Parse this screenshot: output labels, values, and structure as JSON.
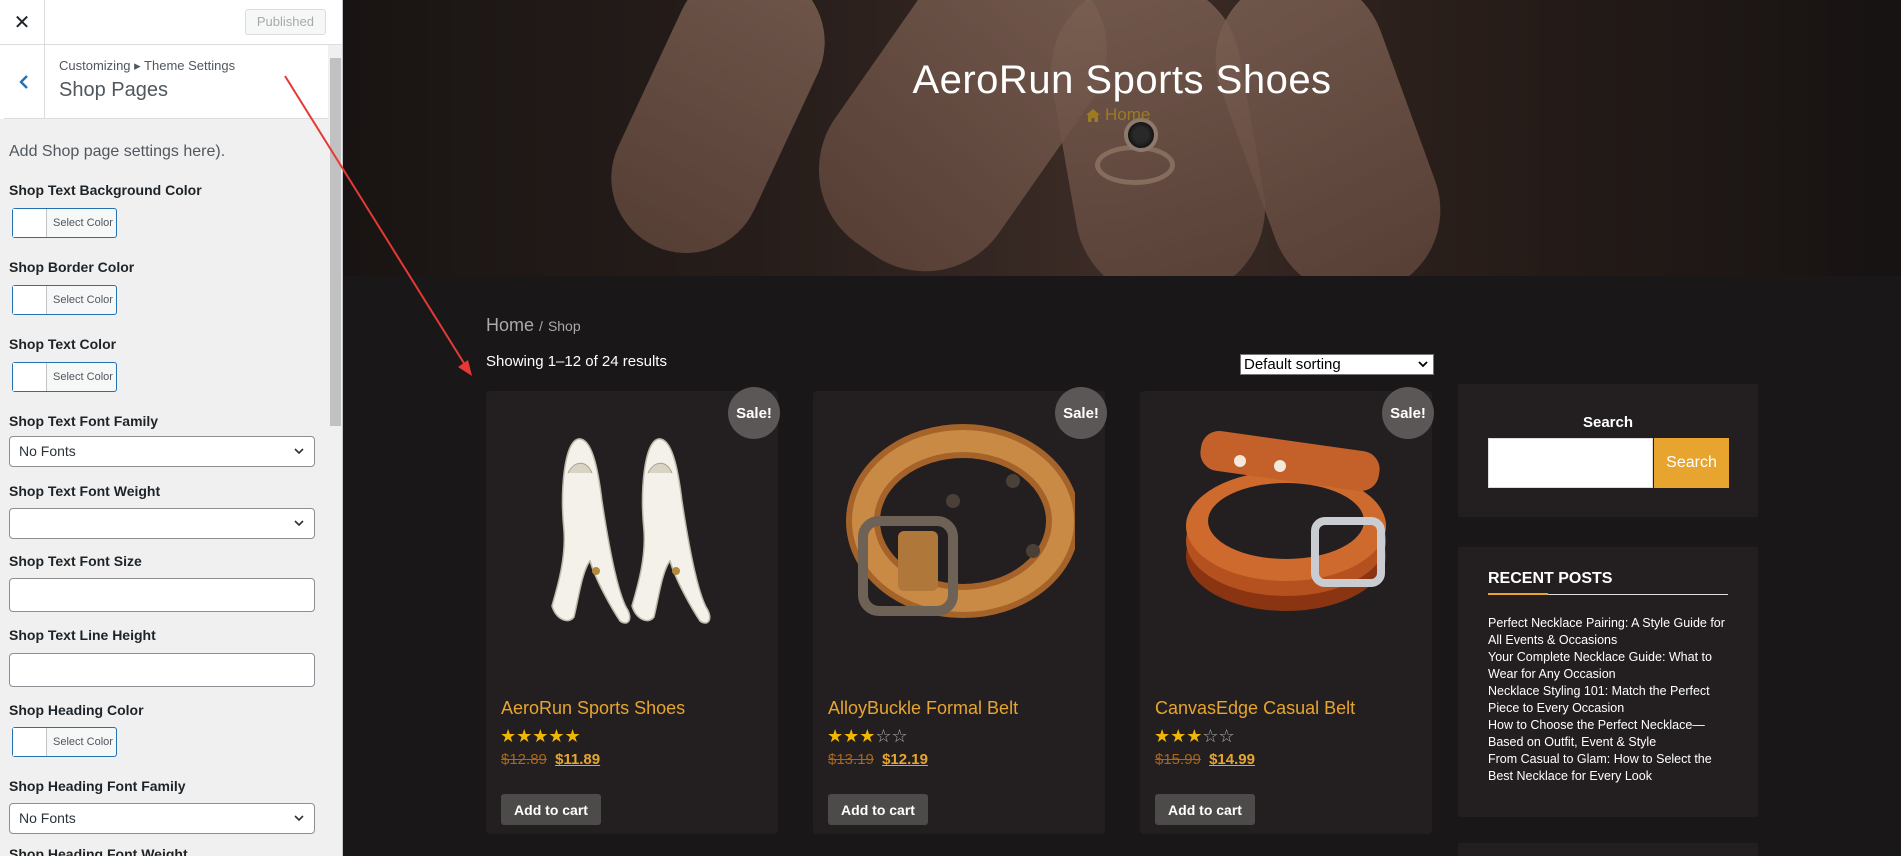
{
  "sidebar": {
    "close_icon": "close-icon",
    "published_label": "Published",
    "breadcrumb": "Customizing ▸ Theme Settings",
    "section_title": "Shop Pages",
    "description": "Add Shop page settings here).",
    "fields": [
      {
        "label": "Shop Text Background Color",
        "type": "color",
        "button": "Select Color"
      },
      {
        "label": "Shop Border Color",
        "type": "color",
        "button": "Select Color"
      },
      {
        "label": "Shop Text Color",
        "type": "color",
        "button": "Select Color"
      },
      {
        "label": "Shop Text Font Family",
        "type": "select",
        "value": "No Fonts"
      },
      {
        "label": "Shop Text Font Weight",
        "type": "select",
        "value": ""
      },
      {
        "label": "Shop Text Font Size",
        "type": "input",
        "value": ""
      },
      {
        "label": "Shop Text Line Height",
        "type": "input",
        "value": ""
      },
      {
        "label": "Shop Heading Color",
        "type": "color",
        "button": "Select Color"
      },
      {
        "label": "Shop Heading Font Family",
        "type": "select",
        "value": "No Fonts"
      },
      {
        "label": "Shop Heading Font Weight",
        "type": "select",
        "value": ""
      }
    ]
  },
  "hero": {
    "title": "AeroRun Sports Shoes",
    "home_label": "Home"
  },
  "shop": {
    "breadcrumb_home": "Home",
    "breadcrumb_sep": "/",
    "breadcrumb_current": "Shop",
    "result_count": "Showing 1–12 of 24 results",
    "sorting": "Default sorting",
    "products": [
      {
        "badge": "Sale!",
        "title": "AeroRun Sports Shoes",
        "rating": 5,
        "old_price": "$12.89",
        "new_price": "$11.89",
        "cart_label": "Add to cart",
        "image": "white-heels"
      },
      {
        "badge": "Sale!",
        "title": "AlloyBuckle Formal Belt",
        "rating": 3,
        "old_price": "$13.19",
        "new_price": "$12.19",
        "cart_label": "Add to cart",
        "image": "brown-belt"
      },
      {
        "badge": "Sale!",
        "title": "CanvasEdge Casual Belt",
        "rating": 3,
        "old_price": "$15.99",
        "new_price": "$14.99",
        "cart_label": "Add to cart",
        "image": "orange-belt"
      }
    ]
  },
  "widgets": {
    "search_title": "Search",
    "search_button": "Search",
    "search_value": "",
    "recent_posts_title": "RECENT POSTS",
    "recent_posts": [
      "Perfect Necklace Pairing: A Style Guide for All Events & Occasions",
      "Your Complete Necklace Guide: What to Wear for Any Occasion",
      "Necklace Styling 101: Match the Perfect Piece to Every Occasion",
      "How to Choose the Perfect Necklace—Based on Outfit, Event & Style",
      "From Casual to Glam: How to Select the Best Necklace for Every Look"
    ]
  },
  "colors": {
    "accent": "#e7a52f",
    "sale_badge": "#5b5757",
    "card_bg": "#231f20",
    "page_bg": "#1a1718",
    "annotation_arrow": "#e53935"
  }
}
